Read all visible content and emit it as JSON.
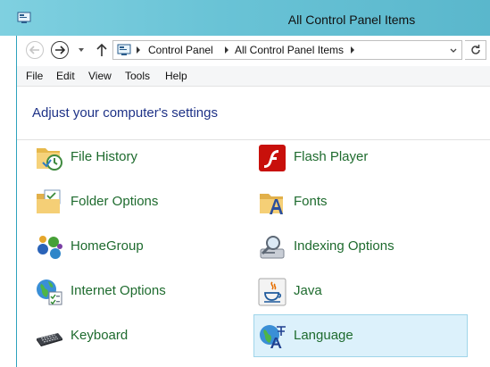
{
  "window": {
    "title": "All Control Panel Items"
  },
  "address": {
    "crumbs": [
      "Control Panel",
      "All Control Panel Items"
    ]
  },
  "menu": [
    "File",
    "Edit",
    "View",
    "Tools",
    "Help"
  ],
  "heading": "Adjust your computer's settings",
  "items": [
    {
      "label": "File History",
      "icon": "file-history-icon"
    },
    {
      "label": "Flash Player",
      "icon": "flash-player-icon"
    },
    {
      "label": "Folder Options",
      "icon": "folder-options-icon"
    },
    {
      "label": "Fonts",
      "icon": "fonts-icon"
    },
    {
      "label": "HomeGroup",
      "icon": "homegroup-icon"
    },
    {
      "label": "Indexing Options",
      "icon": "indexing-options-icon"
    },
    {
      "label": "Internet Options",
      "icon": "internet-options-icon"
    },
    {
      "label": "Java",
      "icon": "java-icon"
    },
    {
      "label": "Keyboard",
      "icon": "keyboard-icon"
    },
    {
      "label": "Language",
      "icon": "language-icon"
    }
  ],
  "colors": {
    "titlebar": "#69c3d6",
    "link_green": "#1e6b2e",
    "heading_blue": "#1e3287",
    "selected_bg": "#dcf1fb"
  }
}
